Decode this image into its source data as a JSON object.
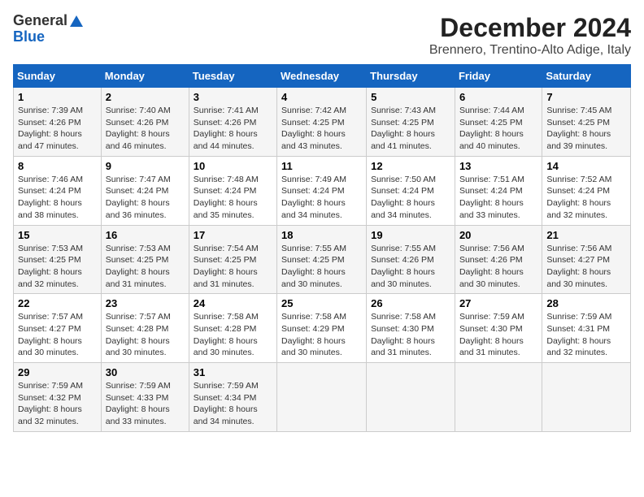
{
  "header": {
    "logo_general": "General",
    "logo_blue": "Blue",
    "title": "December 2024",
    "subtitle": "Brennero, Trentino-Alto Adige, Italy"
  },
  "calendar": {
    "weekdays": [
      "Sunday",
      "Monday",
      "Tuesday",
      "Wednesday",
      "Thursday",
      "Friday",
      "Saturday"
    ],
    "weeks": [
      [
        {
          "day": "1",
          "sunrise": "7:39 AM",
          "sunset": "4:26 PM",
          "daylight": "8 hours and 47 minutes."
        },
        {
          "day": "2",
          "sunrise": "7:40 AM",
          "sunset": "4:26 PM",
          "daylight": "8 hours and 46 minutes."
        },
        {
          "day": "3",
          "sunrise": "7:41 AM",
          "sunset": "4:26 PM",
          "daylight": "8 hours and 44 minutes."
        },
        {
          "day": "4",
          "sunrise": "7:42 AM",
          "sunset": "4:25 PM",
          "daylight": "8 hours and 43 minutes."
        },
        {
          "day": "5",
          "sunrise": "7:43 AM",
          "sunset": "4:25 PM",
          "daylight": "8 hours and 41 minutes."
        },
        {
          "day": "6",
          "sunrise": "7:44 AM",
          "sunset": "4:25 PM",
          "daylight": "8 hours and 40 minutes."
        },
        {
          "day": "7",
          "sunrise": "7:45 AM",
          "sunset": "4:25 PM",
          "daylight": "8 hours and 39 minutes."
        }
      ],
      [
        {
          "day": "8",
          "sunrise": "7:46 AM",
          "sunset": "4:24 PM",
          "daylight": "8 hours and 38 minutes."
        },
        {
          "day": "9",
          "sunrise": "7:47 AM",
          "sunset": "4:24 PM",
          "daylight": "8 hours and 36 minutes."
        },
        {
          "day": "10",
          "sunrise": "7:48 AM",
          "sunset": "4:24 PM",
          "daylight": "8 hours and 35 minutes."
        },
        {
          "day": "11",
          "sunrise": "7:49 AM",
          "sunset": "4:24 PM",
          "daylight": "8 hours and 34 minutes."
        },
        {
          "day": "12",
          "sunrise": "7:50 AM",
          "sunset": "4:24 PM",
          "daylight": "8 hours and 34 minutes."
        },
        {
          "day": "13",
          "sunrise": "7:51 AM",
          "sunset": "4:24 PM",
          "daylight": "8 hours and 33 minutes."
        },
        {
          "day": "14",
          "sunrise": "7:52 AM",
          "sunset": "4:24 PM",
          "daylight": "8 hours and 32 minutes."
        }
      ],
      [
        {
          "day": "15",
          "sunrise": "7:53 AM",
          "sunset": "4:25 PM",
          "daylight": "8 hours and 32 minutes."
        },
        {
          "day": "16",
          "sunrise": "7:53 AM",
          "sunset": "4:25 PM",
          "daylight": "8 hours and 31 minutes."
        },
        {
          "day": "17",
          "sunrise": "7:54 AM",
          "sunset": "4:25 PM",
          "daylight": "8 hours and 31 minutes."
        },
        {
          "day": "18",
          "sunrise": "7:55 AM",
          "sunset": "4:25 PM",
          "daylight": "8 hours and 30 minutes."
        },
        {
          "day": "19",
          "sunrise": "7:55 AM",
          "sunset": "4:26 PM",
          "daylight": "8 hours and 30 minutes."
        },
        {
          "day": "20",
          "sunrise": "7:56 AM",
          "sunset": "4:26 PM",
          "daylight": "8 hours and 30 minutes."
        },
        {
          "day": "21",
          "sunrise": "7:56 AM",
          "sunset": "4:27 PM",
          "daylight": "8 hours and 30 minutes."
        }
      ],
      [
        {
          "day": "22",
          "sunrise": "7:57 AM",
          "sunset": "4:27 PM",
          "daylight": "8 hours and 30 minutes."
        },
        {
          "day": "23",
          "sunrise": "7:57 AM",
          "sunset": "4:28 PM",
          "daylight": "8 hours and 30 minutes."
        },
        {
          "day": "24",
          "sunrise": "7:58 AM",
          "sunset": "4:28 PM",
          "daylight": "8 hours and 30 minutes."
        },
        {
          "day": "25",
          "sunrise": "7:58 AM",
          "sunset": "4:29 PM",
          "daylight": "8 hours and 30 minutes."
        },
        {
          "day": "26",
          "sunrise": "7:58 AM",
          "sunset": "4:30 PM",
          "daylight": "8 hours and 31 minutes."
        },
        {
          "day": "27",
          "sunrise": "7:59 AM",
          "sunset": "4:30 PM",
          "daylight": "8 hours and 31 minutes."
        },
        {
          "day": "28",
          "sunrise": "7:59 AM",
          "sunset": "4:31 PM",
          "daylight": "8 hours and 32 minutes."
        }
      ],
      [
        {
          "day": "29",
          "sunrise": "7:59 AM",
          "sunset": "4:32 PM",
          "daylight": "8 hours and 32 minutes."
        },
        {
          "day": "30",
          "sunrise": "7:59 AM",
          "sunset": "4:33 PM",
          "daylight": "8 hours and 33 minutes."
        },
        {
          "day": "31",
          "sunrise": "7:59 AM",
          "sunset": "4:34 PM",
          "daylight": "8 hours and 34 minutes."
        },
        null,
        null,
        null,
        null
      ]
    ]
  }
}
